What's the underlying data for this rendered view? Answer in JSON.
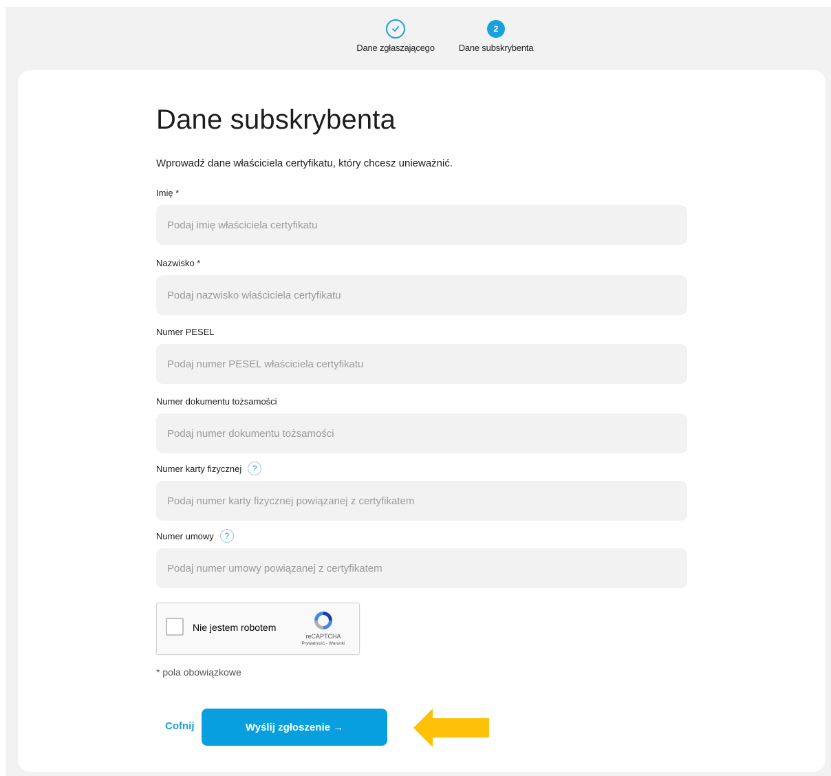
{
  "stepper": {
    "steps": [
      {
        "label": "Dane zgłaszającego",
        "state": "completed"
      },
      {
        "label": "Dane subskrybenta",
        "number": "2",
        "state": "active"
      }
    ]
  },
  "form": {
    "title": "Dane subskrybenta",
    "intro": "Wprowadź dane właściciela certyfikatu, który chcesz unieważnić.",
    "fields": [
      {
        "label": "Imię *",
        "placeholder": "Podaj imię właściciela certyfikatu",
        "value": ""
      },
      {
        "label": "Nazwisko *",
        "placeholder": "Podaj nazwisko właściciela certyfikatu",
        "value": ""
      },
      {
        "label": "Numer PESEL",
        "placeholder": "Podaj numer PESEL właściciela certyfikatu",
        "value": ""
      },
      {
        "label": "Numer dokumentu tożsamości",
        "placeholder": "Podaj numer dokumentu tożsamości",
        "value": ""
      },
      {
        "label": "Numer karty fizycznej",
        "help": "?",
        "placeholder": "Podaj numer karty fizycznej powiązanej z certyfikatem",
        "value": ""
      },
      {
        "label": "Numer umowy",
        "help": "?",
        "placeholder": "Podaj numer umowy powiązanej z certyfikatem",
        "value": ""
      }
    ],
    "recaptcha": {
      "label": "Nie jestem robotem",
      "brand": "reCAPTCHA",
      "links": "Prywatność - Warunki",
      "checked": false
    },
    "required_note": "* pola obowiązkowe",
    "back_label": "Cofnij",
    "submit_label": "Wyślij zgłoszenie →"
  },
  "colors": {
    "accent": "#079fdd",
    "annotation_arrow": "#ffc107",
    "page_background": "#f2f2f2",
    "input_background": "#f2f2f2"
  },
  "icons": {
    "completed_step": "check-circle-icon",
    "help": "question-icon",
    "annotation": "arrow-left-icon"
  }
}
